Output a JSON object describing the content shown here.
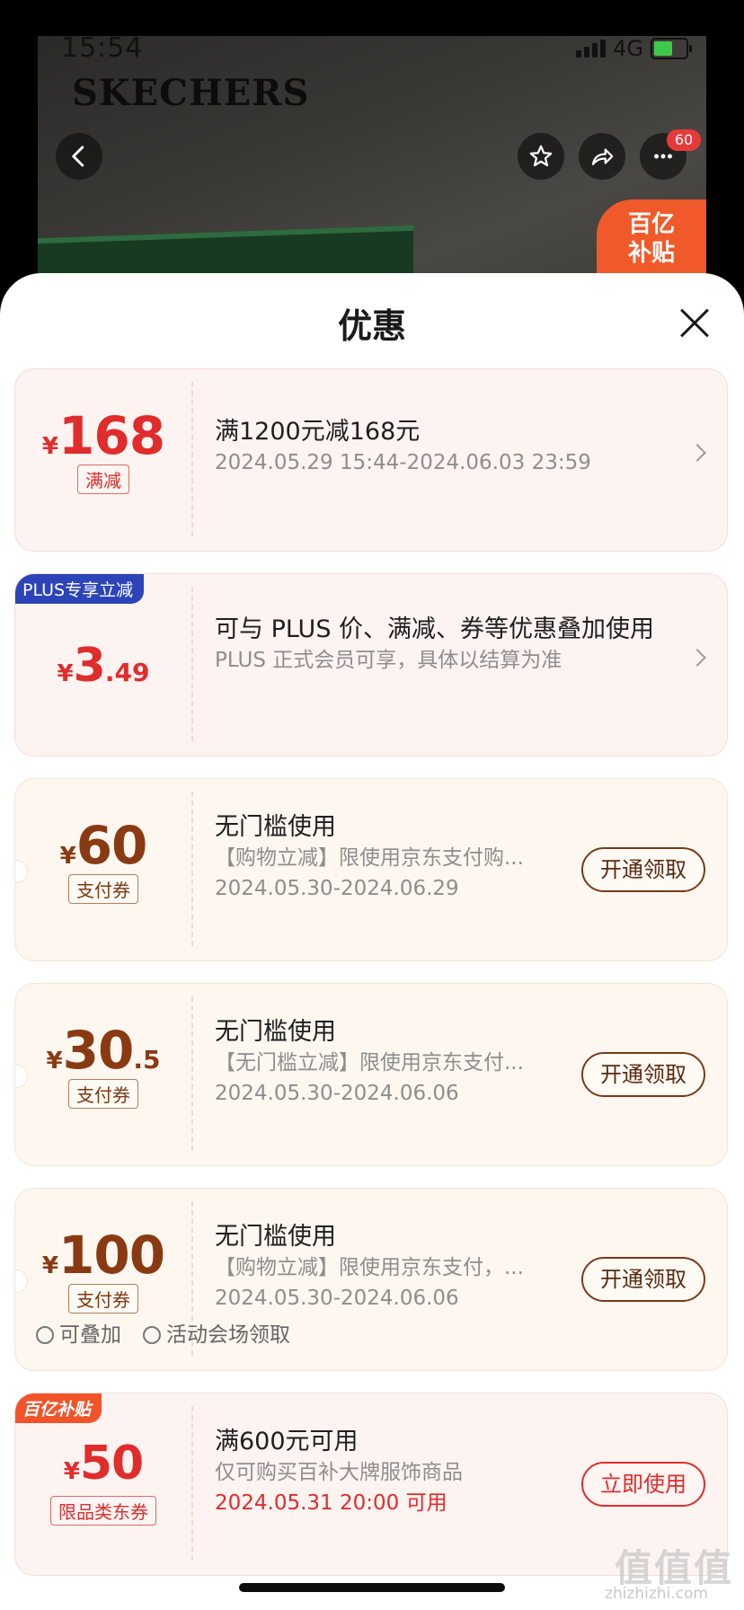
{
  "status_bar": {
    "time": "15:54",
    "network": "4G"
  },
  "product_page": {
    "brand": "SKECHERS",
    "notification_count": "60",
    "subsidy_badge": [
      "百亿",
      "补贴"
    ]
  },
  "sheet": {
    "title": "优惠",
    "coupons": [
      {
        "type": "promo",
        "ribbon": "",
        "currency": "¥",
        "amount_int": "168",
        "amount_dec": "",
        "tag": "满减",
        "main": "满1200元减168元",
        "sub1": "2024.05.29 15:44-2024.06.03 23:59",
        "sub2": "",
        "action": ""
      },
      {
        "type": "plus",
        "ribbon": "PLUS专享立减",
        "currency": "¥",
        "amount_int": "3",
        "amount_dec": ".49",
        "tag": "",
        "main": "可与 PLUS 价、满减、券等优惠叠加使用",
        "sub1": "PLUS 正式会员可享，具体以结算为准",
        "sub2": "",
        "action": ""
      },
      {
        "type": "pay",
        "ribbon": "",
        "currency": "¥",
        "amount_int": "60",
        "amount_dec": "",
        "tag": "支付券",
        "main": "无门槛使用",
        "sub1": "【购物立减】限使用京东支付购...",
        "sub2": "2024.05.30-2024.06.29",
        "action": "开通领取"
      },
      {
        "type": "pay",
        "ribbon": "",
        "currency": "¥",
        "amount_int": "30",
        "amount_dec": ".5",
        "tag": "支付券",
        "main": "无门槛使用",
        "sub1": "【无门槛立减】限使用京东支付...",
        "sub2": "2024.05.30-2024.06.06",
        "action": "开通领取"
      },
      {
        "type": "pay",
        "ribbon": "",
        "currency": "¥",
        "amount_int": "100",
        "amount_dec": "",
        "tag": "支付券",
        "main": "无门槛使用",
        "sub1": "【购物立减】限使用京东支付，...",
        "sub2": "2024.05.30-2024.06.06",
        "action": "开通领取"
      },
      {
        "type": "bybt",
        "ribbon": "百亿补贴",
        "currency": "¥",
        "amount_int": "50",
        "amount_dec": "",
        "tag": "限品类东券",
        "main": "满600元可用",
        "sub1": "仅可购买百补大牌服饰商品",
        "sub2": "2024.05.31 20:00 可用",
        "action": "立即使用"
      }
    ],
    "footer": {
      "stackable": "可叠加",
      "activity": "活动会场领取"
    }
  },
  "watermark": {
    "main": "值值值",
    "small": "zhizhizhi.com"
  },
  "colors": {
    "red": "#e12c2c",
    "brown": "#8a3a12",
    "plus_blue": "#2c44b8",
    "subsidy_orange": "#f2542a"
  }
}
